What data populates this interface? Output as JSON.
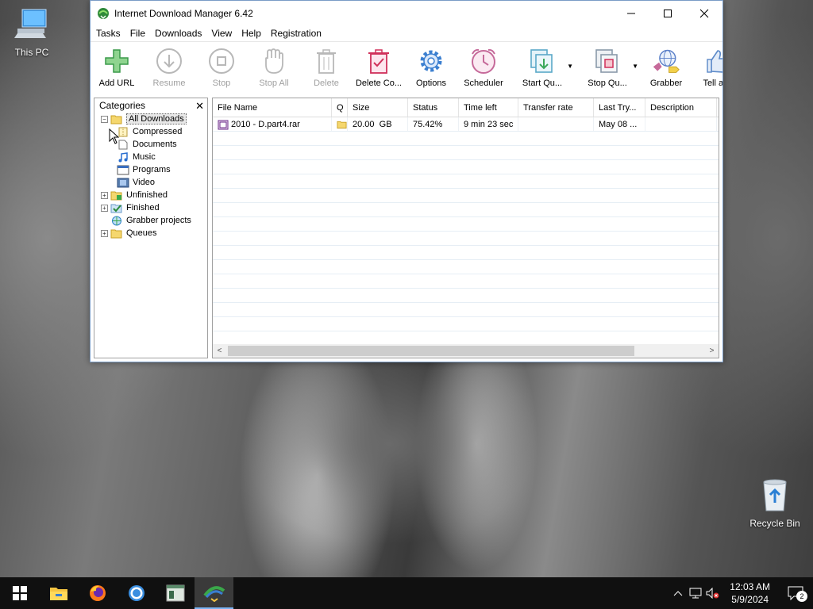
{
  "desktop": {
    "this_pc": "This PC",
    "recycle_bin": "Recycle Bin"
  },
  "window": {
    "title": "Internet Download Manager 6.42",
    "menu": [
      "Tasks",
      "File",
      "Downloads",
      "View",
      "Help",
      "Registration"
    ],
    "toolbar": [
      {
        "label": "Add URL",
        "icon": "add-url-icon",
        "enabled": true
      },
      {
        "label": "Resume",
        "icon": "resume-icon",
        "enabled": false
      },
      {
        "label": "Stop",
        "icon": "stop-icon",
        "enabled": false
      },
      {
        "label": "Stop All",
        "icon": "stop-all-icon",
        "enabled": false
      },
      {
        "label": "Delete",
        "icon": "delete-icon",
        "enabled": false
      },
      {
        "label": "Delete Co...",
        "icon": "delete-completed-icon",
        "enabled": true
      },
      {
        "label": "Options",
        "icon": "options-icon",
        "enabled": true
      },
      {
        "label": "Scheduler",
        "icon": "scheduler-icon",
        "enabled": true
      },
      {
        "label": "Start Qu...",
        "icon": "start-queue-icon",
        "enabled": true
      },
      {
        "label": "Stop Qu...",
        "icon": "stop-queue-icon",
        "enabled": true
      },
      {
        "label": "Grabber",
        "icon": "grabber-icon",
        "enabled": true
      },
      {
        "label": "Tell a Fr",
        "icon": "tell-a-friend-icon",
        "enabled": true
      }
    ],
    "categories": {
      "header": "Categories",
      "close": "✕",
      "all_downloads": "All Downloads",
      "children": [
        "Compressed",
        "Documents",
        "Music",
        "Programs",
        "Video"
      ],
      "others": [
        "Unfinished",
        "Finished",
        "Grabber projects",
        "Queues"
      ]
    },
    "columns": [
      "File Name",
      "Q",
      "Size",
      "Status",
      "Time left",
      "Transfer rate",
      "Last Try...",
      "Description"
    ],
    "rows": [
      {
        "file_name": "2010 - D.part4.rar",
        "q": "",
        "size": "20.00  GB",
        "status": "75.42%",
        "time_left": "9 min 23 sec",
        "transfer_rate": "",
        "last_try": "May 08 ...",
        "description": ""
      }
    ]
  },
  "taskbar": {
    "time": "12:03 AM",
    "date": "5/9/2024",
    "notification_count": "2"
  }
}
